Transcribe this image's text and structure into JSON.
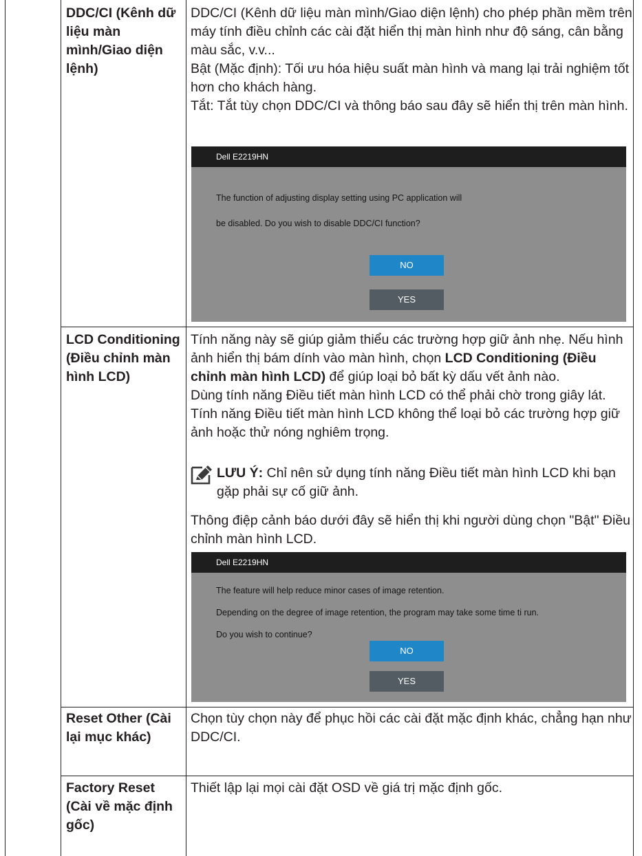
{
  "rows": [
    {
      "label": "DDC/CI (Kênh dữ liệu màn mình/Giao diện lệnh)",
      "paragraphs": [
        "DDC/CI (Kênh dữ liệu màn mình/Giao diện lệnh) cho phép phần mềm trên máy tính điều chỉnh các cài đặt hiển thị màn hình như độ sáng, cân bằng màu sắc, v.v...",
        "Bật (Mặc định): Tối ưu hóa hiệu suất màn hình và mang lại trải nghiệm tốt hơn cho khách hàng.",
        "Tắt: Tắt tùy chọn DDC/CI và thông báo sau đây sẽ hiển thị trên màn hình."
      ],
      "dialog": {
        "title": "Dell E2219HN",
        "lines": [
          "The function of adjusting display setting using PC application will",
          "be disabled. Do you wish to disable DDC/CI function?"
        ],
        "no_label": "NO",
        "yes_label": "YES"
      }
    },
    {
      "label": "LCD Conditioning (Điều chỉnh màn hình LCD)",
      "para1_before": "Tính năng này sẽ giúp giảm thiểu các trường hợp giữ ảnh nhẹ. Nếu hình ảnh hiển thị bám dính vào màn hình, chọn ",
      "para1_bold": "LCD Conditioning (Điều chỉnh màn hình LCD)",
      "para1_after": " để giúp loại bỏ bất kỳ dấu vết ảnh nào.",
      "para2": "Dùng tính năng Điều tiết màn hình LCD có thể phải chờ trong giây lát. Tính năng Điều tiết màn hình LCD không thể loại bỏ các trường hợp giữ ảnh hoặc thử nóng nghiêm trọng.",
      "note_label": "LƯU Ý:",
      "note_text": " Chỉ nên sử dụng tính năng Điều tiết màn hình LCD khi bạn gặp phải sự cố giữ ảnh.",
      "para3": "Thông điệp cảnh báo dưới đây sẽ hiển thị khi người dùng chọn \"Bật\" Điều chỉnh màn hình LCD.",
      "dialog": {
        "title": "Dell E2219HN",
        "lines": [
          "The feature will help reduce minor cases of image retention.",
          "Depending on the degree of image retention, the program may take some time ti run.",
          "Do you wish to continue?"
        ],
        "no_label": "NO",
        "yes_label": "YES"
      }
    },
    {
      "label": "Reset Other (Cài lại mục khác)",
      "text": "Chọn tùy chọn này để phục hồi các cài đặt mặc định khác, chẳng hạn như DDC/CI."
    },
    {
      "label": "Factory Reset (Cài về mặc định gốc)",
      "text": "Thiết lập lại mọi cài đặt OSD về giá trị mặc định gốc."
    }
  ],
  "icons": {
    "note": "pencil-note-icon"
  }
}
